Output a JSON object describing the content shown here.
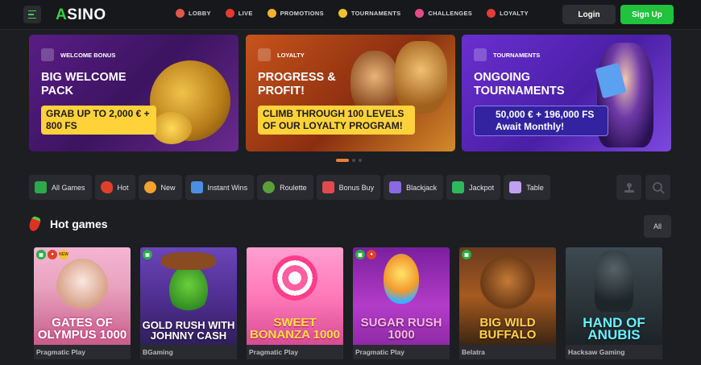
{
  "header": {
    "logo_a": "A",
    "logo_rest": "SINO",
    "nav": [
      {
        "label": "LOBBY",
        "icon": "slot-machine-icon",
        "color": "#e2574c"
      },
      {
        "label": "LIVE",
        "icon": "live-badge-icon",
        "color": "#e63a2e"
      },
      {
        "label": "PROMOTIONS",
        "icon": "megaphone-icon",
        "color": "#f2b230"
      },
      {
        "label": "TOURNAMENTS",
        "icon": "trophy-icon",
        "color": "#f2c12e"
      },
      {
        "label": "CHALLENGES",
        "icon": "target-icon",
        "color": "#e54b8a"
      },
      {
        "label": "LOYALTY",
        "icon": "gift-bow-icon",
        "color": "#e53b3b"
      }
    ],
    "login_label": "Login",
    "signup_label": "Sign Up"
  },
  "banners": [
    {
      "tag": "WELCOME BONUS",
      "title": "BIG WELCOME PACK",
      "pill": "GRAB UP TO 2,000 € + 800 FS"
    },
    {
      "tag": "LOYALTY",
      "title": "PROGRESS & PROFIT!",
      "pill": "CLIMB THROUGH 100 LEVELS OF OUR LOYALTY PROGRAM!"
    },
    {
      "tag": "TOURNAMENTS",
      "title": "ONGOING TOURNAMENTS",
      "pill": "50,000 € + 196,000 FS Await Monthly!"
    }
  ],
  "carousel": {
    "active_index": 0,
    "count": 3
  },
  "categories": [
    {
      "label": "All Games",
      "icon": "all-games-icon",
      "color": "#2fa84a"
    },
    {
      "label": "Hot",
      "icon": "chili-icon",
      "color": "#e0402a"
    },
    {
      "label": "New",
      "icon": "new-badge-icon",
      "color": "#f2a22e"
    },
    {
      "label": "Instant Wins",
      "icon": "rocket-icon",
      "color": "#4a8fe0"
    },
    {
      "label": "Roulette",
      "icon": "roulette-icon",
      "color": "#5b9f3a"
    },
    {
      "label": "Bonus Buy",
      "icon": "bonus-gift-icon",
      "color": "#e04a50"
    },
    {
      "label": "Blackjack",
      "icon": "playing-cards-icon",
      "color": "#8a6ae0"
    },
    {
      "label": "Jackpot",
      "icon": "jackpot-chest-icon",
      "color": "#2fb85a"
    },
    {
      "label": "Table",
      "icon": "table-icon",
      "color": "#c0a0f0"
    }
  ],
  "section": {
    "title": "Hot games",
    "all_label": "All"
  },
  "games": [
    {
      "title": "GATES OF OLYMPUS 1000",
      "provider": "Pragmatic Play",
      "badges": [
        "gift",
        "hot",
        "new"
      ]
    },
    {
      "title": "GOLD RUSH WITH JOHNNY CASH",
      "provider": "BGaming",
      "badges": [
        "gift"
      ]
    },
    {
      "title": "SWEET BONANZA 1000",
      "provider": "Pragmatic Play",
      "badges": []
    },
    {
      "title": "SUGAR RUSH 1000",
      "provider": "Pragmatic Play",
      "badges": [
        "gift",
        "hot"
      ]
    },
    {
      "title": "BIG WILD BUFFALO",
      "provider": "Belatra",
      "badges": [
        "gift"
      ]
    },
    {
      "title": "HAND OF ANUBIS",
      "provider": "Hacksaw Gaming",
      "badges": []
    }
  ]
}
